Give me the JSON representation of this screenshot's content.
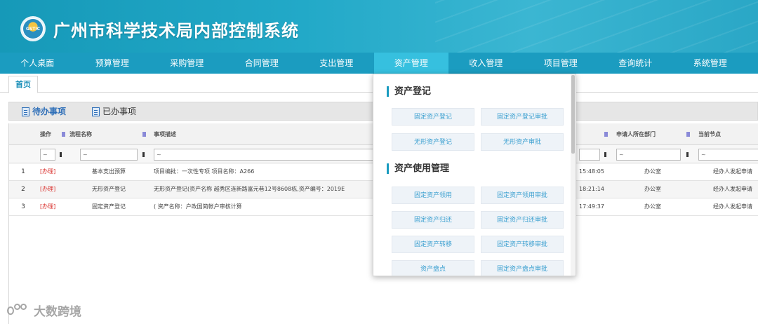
{
  "app": {
    "logo_text": "GSTIC",
    "title": "广州市科学技术局内部控制系统"
  },
  "nav": {
    "items": [
      "个人桌面",
      "预算管理",
      "采购管理",
      "合同管理",
      "支出管理",
      "资产管理",
      "收入管理",
      "项目管理",
      "查询统计",
      "系统管理"
    ],
    "active_index": 5
  },
  "tabs": {
    "home": "首页"
  },
  "todo": {
    "pending_label": "待办事项",
    "done_label": "已办事项"
  },
  "grid": {
    "columns": [
      "操作",
      "流程名称",
      "事项描述",
      "申请人所在部门",
      "当前节点"
    ],
    "filter_placeholder": "~",
    "rows": [
      {
        "num": "1",
        "op": "[办理]",
        "process": "基本支出预算",
        "desc": "项目编批：一次性专项 项目名称：A266",
        "time": "15:48:05",
        "dept": "办公室",
        "node": "经办人发起申请"
      },
      {
        "num": "2",
        "op": "[办理]",
        "process": "无形资产登记",
        "desc": "无形资产登记(资产名称 越秀区连新路富元巷12号8608栋,资产编号：2019E",
        "time": "18:21:14",
        "dept": "办公室",
        "node": "经办人发起申请"
      },
      {
        "num": "3",
        "op": "[办理]",
        "process": "固定资产登记",
        "desc": "( 资产名称：户政国简帐户审核计算",
        "time": "17:49:37",
        "dept": "办公室",
        "node": "经办人发起申请"
      }
    ]
  },
  "dropdown": {
    "section1_title": "资产登记",
    "section1_items": [
      "固定资产登记",
      "固定资产登记审批",
      "无形资产登记",
      "无形资产审批"
    ],
    "section2_title": "资产使用管理",
    "section2_items": [
      "固定资产领用",
      "固定资产领用审批",
      "固定资产归还",
      "固定资产归还审批",
      "固定资产转移",
      "固定资产转移审批",
      "资产盘点",
      "固定资产盘点审批"
    ]
  },
  "watermark": "大数跨境",
  "colors": {
    "header": "#1b9cc0",
    "nav_active": "#36c0df",
    "action_red": "#d9302c",
    "link_blue": "#3a9fd0"
  }
}
